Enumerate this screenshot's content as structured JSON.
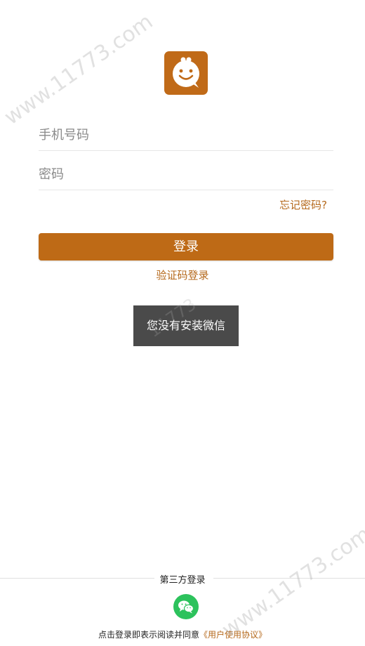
{
  "login": {
    "phone_placeholder": "手机号码",
    "password_placeholder": "密码",
    "forgot_label": "忘记密码?",
    "login_label": "登录",
    "sms_login_label": "验证码登录"
  },
  "toast": {
    "message": "您没有安装微信"
  },
  "third_party": {
    "title": "第三方登录",
    "icon": "wechat-icon"
  },
  "agreement": {
    "prefix": "点击登录即表示阅读并同意",
    "link": "《用户使用协议》"
  },
  "watermark": {
    "text_top": "www.11773.com",
    "text_mid": "11773",
    "text_bottom": "www.11773.com"
  },
  "colors": {
    "accent": "#BE6A16",
    "link": "#B5691C",
    "toast_bg": "#4A4A4A",
    "wechat": "#2CC25C"
  }
}
